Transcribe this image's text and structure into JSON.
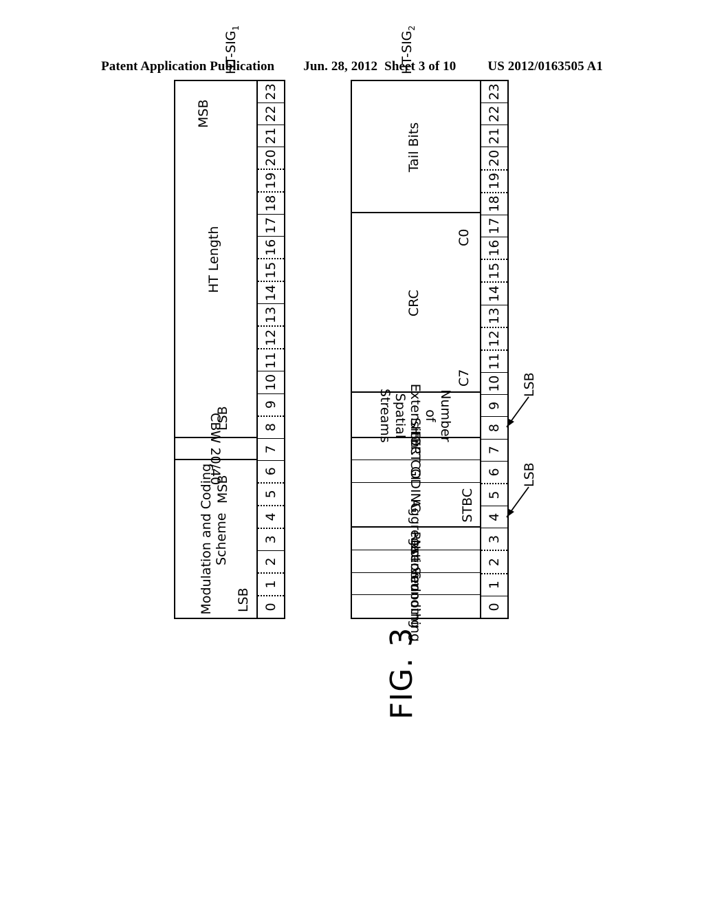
{
  "header": {
    "publication": "Patent Application Publication",
    "date": "Jun. 28, 2012",
    "sheet": "Sheet 3 of 10",
    "docnum": "US 2012/0163505 A1"
  },
  "figure": {
    "title": "FIG. 3",
    "rows": [
      {
        "name": "HT-SIG",
        "subscript": "1",
        "bits": [
          "0",
          "1",
          "2",
          "3",
          "4",
          "5",
          "6",
          "7",
          "8",
          "9",
          "10",
          "11",
          "12",
          "13",
          "14",
          "15",
          "16",
          "17",
          "18",
          "19",
          "20",
          "21",
          "22",
          "23"
        ],
        "fields": [
          {
            "label": "Modulation and Coding Scheme",
            "start": 0,
            "end": 6
          },
          {
            "label": "CBW 20/40",
            "start": 7,
            "end": 7
          },
          {
            "label": "HT Length",
            "start": 8,
            "end": 23
          }
        ],
        "markers": [
          {
            "text": "LSB",
            "bit": 0
          },
          {
            "text": "MSB",
            "bit": 6
          },
          {
            "text": "LSB",
            "bit": 8
          },
          {
            "text": "MSB",
            "bit": 23
          }
        ]
      },
      {
        "name": "HT-SIG",
        "subscript": "2",
        "bits": [
          "0",
          "1",
          "2",
          "3",
          "4",
          "5",
          "6",
          "7",
          "8",
          "9",
          "10",
          "11",
          "12",
          "13",
          "14",
          "15",
          "16",
          "17",
          "18",
          "19",
          "20",
          "21",
          "22",
          "23"
        ],
        "fields": [
          {
            "label": "Smoothing",
            "start": 0,
            "end": 0
          },
          {
            "label": "Not Sounding",
            "start": 1,
            "end": 1
          },
          {
            "label": "Reserved",
            "start": 2,
            "end": 2
          },
          {
            "label": "Aggregation",
            "start": 3,
            "end": 3
          },
          {
            "label": "STBC",
            "start": 4,
            "end": 5
          },
          {
            "label": "FEC CODING",
            "start": 6,
            "end": 6
          },
          {
            "label": "SHORT GI",
            "start": 7,
            "end": 7
          },
          {
            "label": "Number of Extension Spatial Streams",
            "start": 8,
            "end": 9
          },
          {
            "label": "CRC",
            "start": 10,
            "end": 17
          },
          {
            "label": "Tail Bits",
            "start": 18,
            "end": 23
          }
        ],
        "markers": [
          {
            "text": "C7",
            "bit": 11
          },
          {
            "text": "C0",
            "bit": 17
          }
        ],
        "callouts": [
          {
            "text": "LSB",
            "bit": 4
          },
          {
            "text": "LSB",
            "bit": 8
          }
        ]
      }
    ]
  }
}
